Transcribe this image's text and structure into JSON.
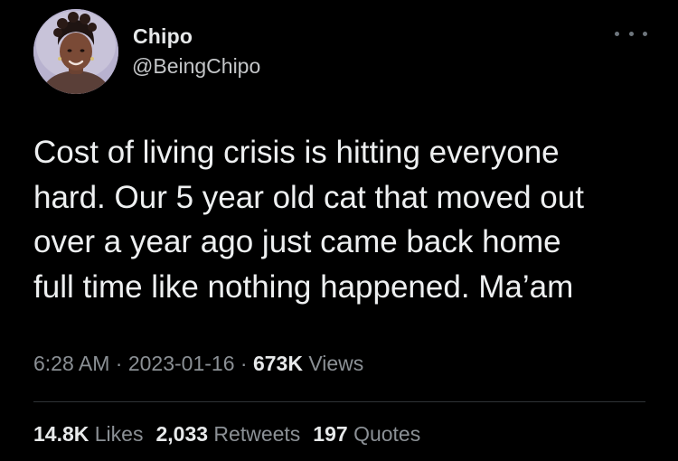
{
  "author": {
    "name": "Chipo",
    "handle": "@BeingChipo",
    "avatar_icon": "profile-photo"
  },
  "more_icon": "ellipsis-icon",
  "tweet": {
    "lines": [
      "Cost of living crisis is hitting everyone",
      "hard. Our 5 year old cat that moved out",
      "over a year ago just came back home",
      "full time like nothing happened. Ma’am"
    ]
  },
  "meta": {
    "time": "6:28 AM",
    "separator": "·",
    "date": "2023-01-16",
    "views_count": "673K",
    "views_label": "Views"
  },
  "stats": {
    "likes_count": "14.8K",
    "likes_label": "Likes",
    "retweets_count": "2,033",
    "retweets_label": "Retweets",
    "quotes_count": "197",
    "quotes_label": "Quotes"
  },
  "colors": {
    "background": "#000000",
    "primary_text": "#e7e9ea",
    "secondary_text": "#8b9095",
    "divider": "#2f3336"
  }
}
